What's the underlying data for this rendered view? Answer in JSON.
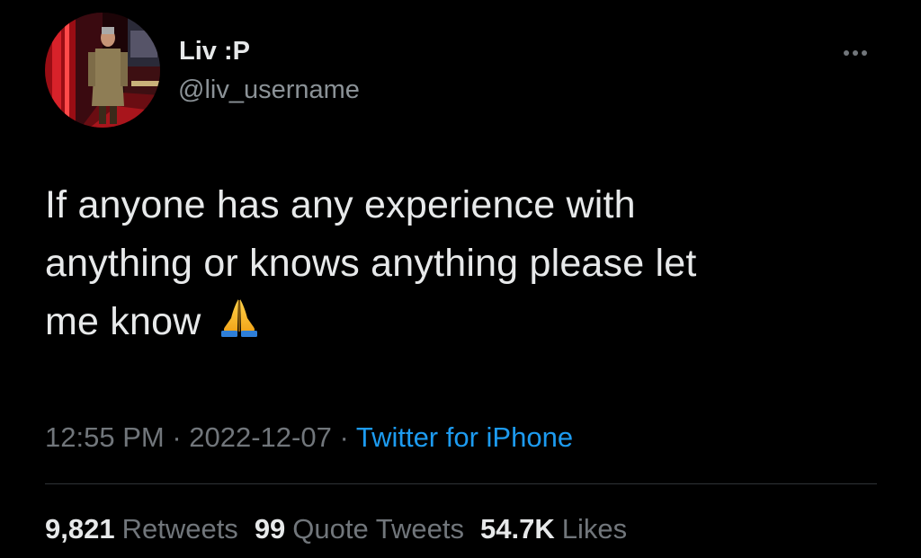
{
  "author": {
    "display_name": "Liv :P",
    "handle": "@liv_username",
    "avatar_icon": "profile-photo"
  },
  "tweet": {
    "text_lines": [
      "If anyone has any experience with",
      "anything or knows anything please let",
      "me know"
    ],
    "emoji": "folded-hands-emoji"
  },
  "meta": {
    "time": "12:55 PM",
    "separator": " · ",
    "date": "2022-12-07",
    "source": "Twitter for iPhone"
  },
  "stats": {
    "retweets_count": "9,821",
    "retweets_label": "Retweets",
    "quotes_count": "99",
    "quotes_label": "Quote Tweets",
    "likes_count": "54.7K",
    "likes_label": "Likes"
  },
  "colors": {
    "background": "#000000",
    "text": "#e7e9ea",
    "muted": "#71767b",
    "link": "#1d9bf0",
    "divider": "#2f3336"
  }
}
